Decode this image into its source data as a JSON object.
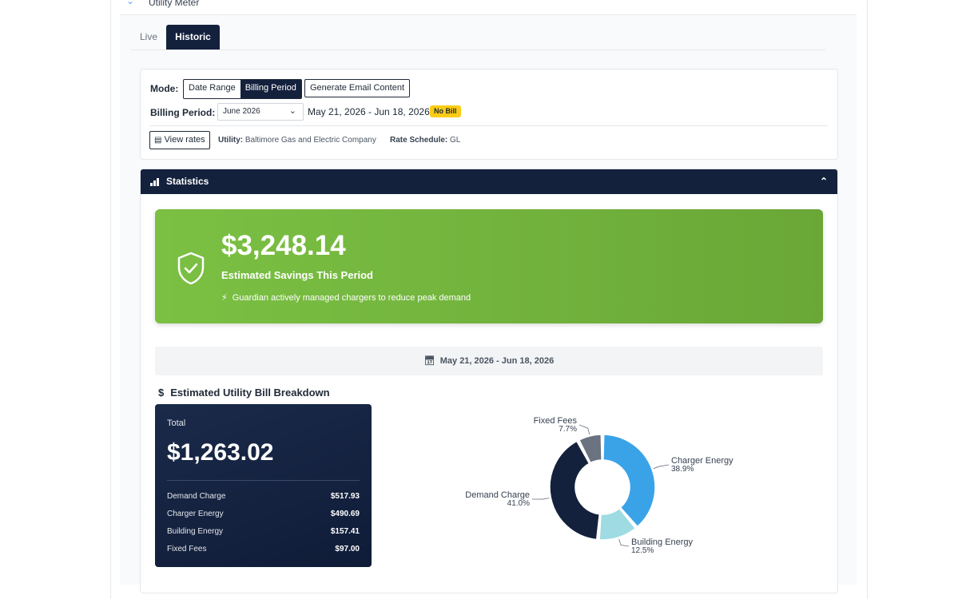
{
  "accordion": {
    "title": "Utility Meter"
  },
  "tabs": [
    {
      "label": "Live"
    },
    {
      "label": "Historic"
    }
  ],
  "config": {
    "mode_label": "Mode:",
    "mode_options": [
      "Date Range",
      "Billing Period"
    ],
    "mode_selected": "Billing Period",
    "email_button": "Generate Email Content",
    "billing_period_label": "Billing Period:",
    "billing_period_value": "June 2026",
    "date_range": "May 21, 2026 - Jun 18, 2026",
    "badge": "No Bill",
    "view_rates": "View rates",
    "utility_label": "Utility:",
    "utility_value": "Baltimore Gas and Electric Company",
    "rate_label": "Rate Schedule:",
    "rate_value": "GL"
  },
  "statistics": {
    "title": "Statistics",
    "savings_amount": "$3,248.14",
    "savings_label": "Estimated Savings This Period",
    "savings_note": "Guardian actively managed chargers to reduce peak demand",
    "period": "May 21, 2026 - Jun 18, 2026",
    "breakdown_title": "Estimated Utility Bill Breakdown",
    "total_label": "Total",
    "total_value": "$1,263.02",
    "items": [
      {
        "name": "Demand Charge",
        "value": "$517.93"
      },
      {
        "name": "Charger Energy",
        "value": "$490.69"
      },
      {
        "name": "Building Energy",
        "value": "$157.41"
      },
      {
        "name": "Fixed Fees",
        "value": "$97.00"
      }
    ]
  },
  "chart_data": {
    "type": "pie",
    "categories": [
      "Charger Energy",
      "Building Energy",
      "Demand Charge",
      "Fixed Fees"
    ],
    "values": [
      38.9,
      12.5,
      41.0,
      7.7
    ],
    "labels": [
      "38.9%",
      "12.5%",
      "41.0%",
      "7.7%"
    ],
    "colors": [
      "#3aa3e8",
      "#9edbe3",
      "#14213d",
      "#6b7280"
    ]
  }
}
